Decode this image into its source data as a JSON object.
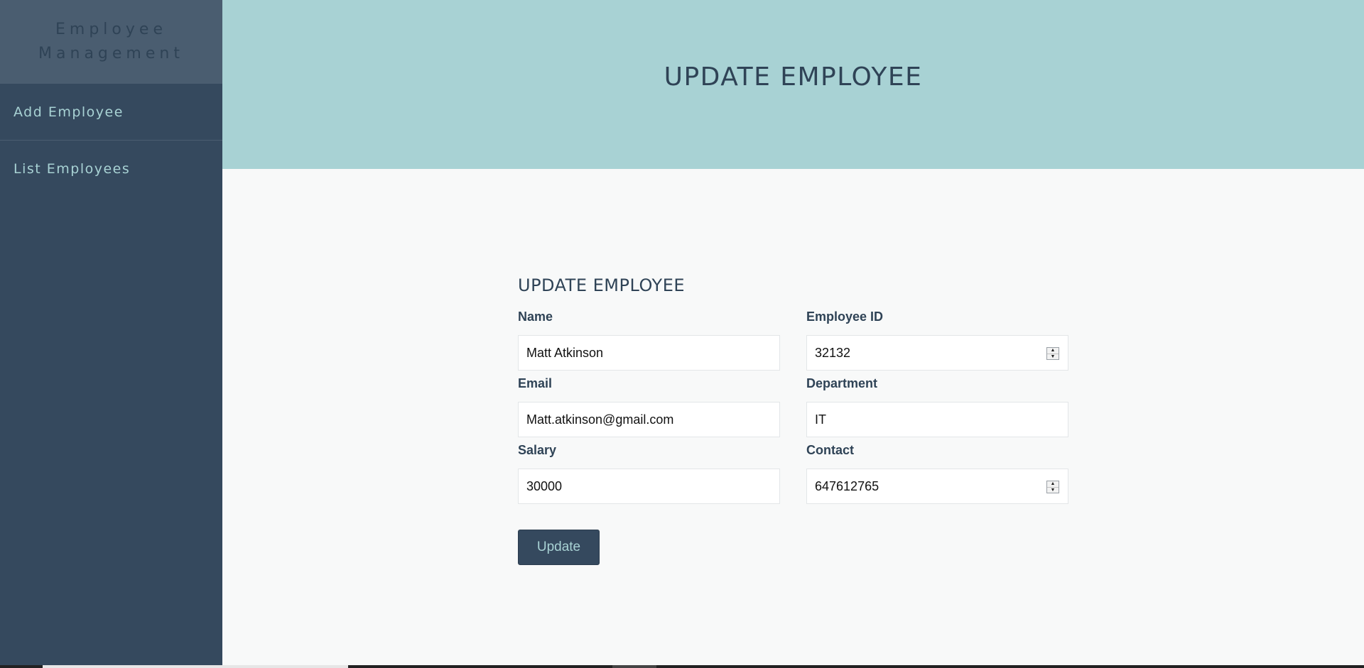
{
  "sidebar": {
    "brand": "Employee Management",
    "items": [
      {
        "label": "Add Employee"
      },
      {
        "label": "List Employees"
      }
    ]
  },
  "header": {
    "title": "UPDATE EMPLOYEE"
  },
  "form": {
    "title": "UPDATE EMPLOYEE",
    "fields": {
      "name": {
        "label": "Name",
        "value": "Matt Atkinson"
      },
      "employee_id": {
        "label": "Employee ID",
        "value": "32132"
      },
      "email": {
        "label": "Email",
        "value": "Matt.atkinson@gmail.com"
      },
      "department": {
        "label": "Department",
        "value": "IT"
      },
      "salary": {
        "label": "Salary",
        "value": "30000"
      },
      "contact": {
        "label": "Contact",
        "value": "647612765"
      }
    },
    "submit_label": "Update"
  },
  "colors": {
    "sidebar": "#35495e",
    "accent": "#a8d2d4",
    "text_dark": "#2f4356"
  }
}
